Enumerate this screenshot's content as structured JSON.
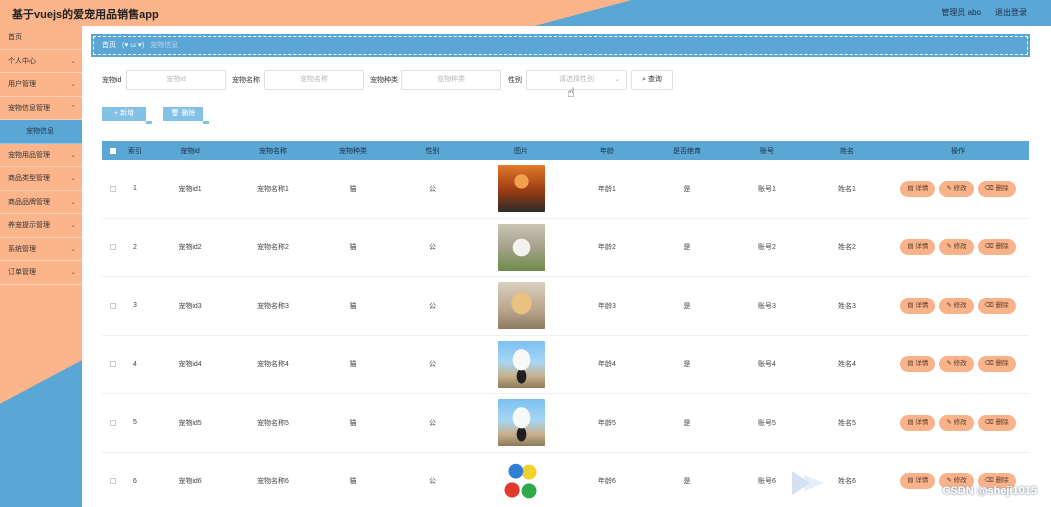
{
  "header": {
    "title": "基于vuejs的爱宠用品销售app",
    "user": "管理员 abo",
    "logout": "退出登录"
  },
  "sidebar": {
    "items": [
      {
        "label": "首页",
        "chevron": ""
      },
      {
        "label": "个人中心",
        "chevron": "⌄"
      },
      {
        "label": "用户管理",
        "chevron": "⌄"
      },
      {
        "label": "宠物信息管理",
        "chevron": "⌃"
      },
      {
        "label": "宠物信息",
        "chevron": ""
      },
      {
        "label": "宠物用品管理",
        "chevron": "⌄"
      },
      {
        "label": "商品类型管理",
        "chevron": "⌄"
      },
      {
        "label": "商品品牌管理",
        "chevron": "⌄"
      },
      {
        "label": "养宠提示管理",
        "chevron": "⌄"
      },
      {
        "label": "系统管理",
        "chevron": "⌄"
      },
      {
        "label": "订单管理",
        "chevron": "⌄"
      }
    ]
  },
  "breadcrumb": {
    "home": "首页",
    "hearts": "(♥ ω ♥)",
    "current": "宠物信息"
  },
  "search": {
    "pet_id_label": "宠物id",
    "pet_id_placeholder": "宠物id",
    "pet_name_label": "宠物名称",
    "pet_name_placeholder": "宠物名称",
    "pet_type_label": "宠物种类",
    "pet_type_placeholder": "宠物种类",
    "gender_label": "性别",
    "gender_placeholder": "请选择性别",
    "query_label": "查询",
    "query_icon": "search-icon"
  },
  "actions": {
    "add_label": "新增",
    "delete_label": "删除"
  },
  "table": {
    "columns": [
      "索引",
      "宠物id",
      "宠物名称",
      "宠物种类",
      "性别",
      "图片",
      "年龄",
      "是否绝育",
      "账号",
      "姓名",
      "操作"
    ],
    "ops": {
      "detail": "详情",
      "edit": "修改",
      "delete": "删除"
    },
    "rows": [
      {
        "index": "1",
        "pet_id": "宠物id1",
        "pet_name": "宠物名称1",
        "type": "猫",
        "gender": "公",
        "image": "photo-long-haired-doll",
        "age": "年龄1",
        "neutered": "是",
        "account": "账号1",
        "name": "姓名1"
      },
      {
        "index": "2",
        "pet_id": "宠物id2",
        "pet_name": "宠物名称2",
        "type": "猫",
        "gender": "公",
        "image": "photo-white-dog-on-grass",
        "age": "年龄2",
        "neutered": "是",
        "account": "账号2",
        "name": "姓名2"
      },
      {
        "index": "3",
        "pet_id": "宠物id3",
        "pet_name": "宠物名称3",
        "type": "猫",
        "gender": "公",
        "image": "photo-golden-puppy",
        "age": "年龄3",
        "neutered": "是",
        "account": "账号3",
        "name": "姓名3"
      },
      {
        "index": "4",
        "pet_id": "宠物id4",
        "pet_name": "宠物名称4",
        "type": "猫",
        "gender": "公",
        "image": "photo-white-fluffy-dog-outdoors",
        "age": "年龄4",
        "neutered": "是",
        "account": "账号4",
        "name": "姓名4"
      },
      {
        "index": "5",
        "pet_id": "宠物id5",
        "pet_name": "宠物名称5",
        "type": "猫",
        "gender": "公",
        "image": "photo-white-fluffy-dog-outdoors",
        "age": "年龄5",
        "neutered": "是",
        "account": "账号5",
        "name": "姓名5"
      },
      {
        "index": "6",
        "pet_id": "宠物id6",
        "pet_name": "宠物名称6",
        "type": "猫",
        "gender": "公",
        "image": "photo-colorful-pet-toy-balls",
        "age": "年龄6",
        "neutered": "是",
        "account": "账号6",
        "name": "姓名6"
      }
    ]
  },
  "watermark": {
    "text": "CSDN @sheji1015"
  },
  "colors": {
    "accent_blue": "#5aa6d4",
    "accent_peach": "#fcb48a",
    "op_button": "#f9b38a"
  }
}
